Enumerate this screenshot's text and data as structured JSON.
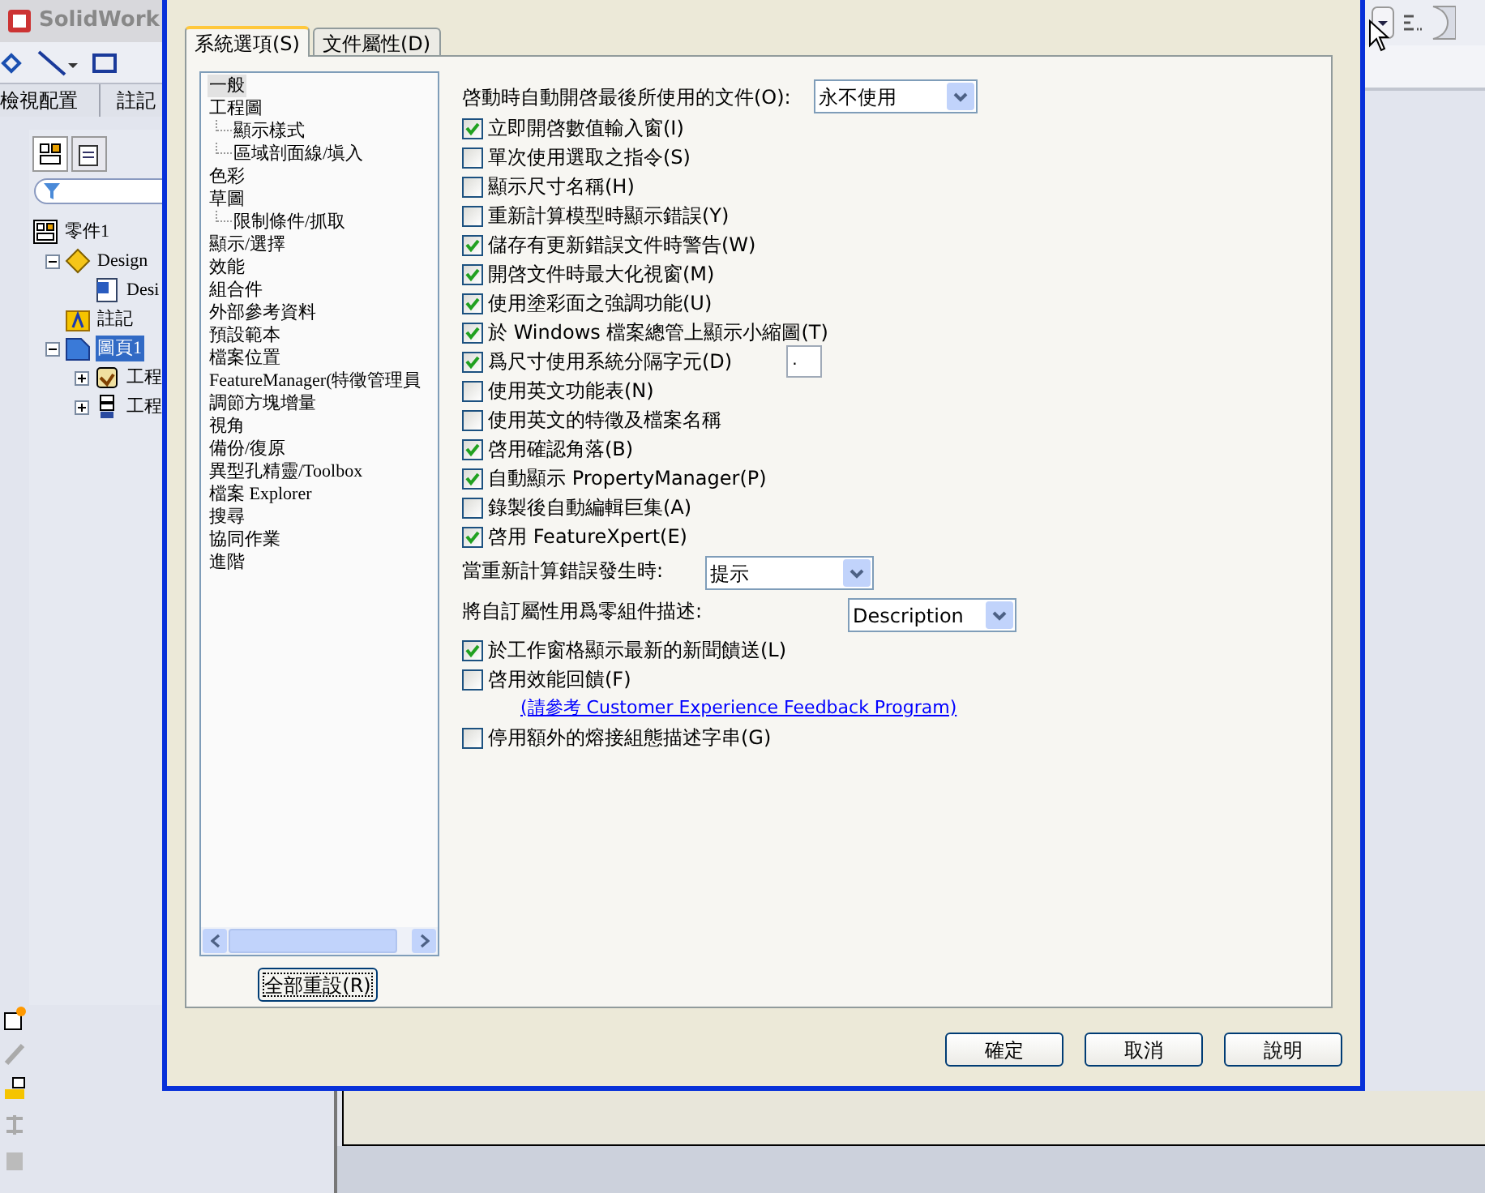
{
  "app": {
    "title": "SolidWork",
    "tabs": [
      {
        "label": "檢視配置",
        "selected": false
      },
      {
        "label": "註記",
        "selected": false
      }
    ],
    "tree": [
      {
        "label": "零件1",
        "selected": false,
        "children": [
          {
            "label": "Design",
            "selected": false,
            "expanded": true,
            "children": [
              {
                "label": "Desi",
                "selected": false
              }
            ]
          },
          {
            "label": "註記",
            "selected": false
          },
          {
            "label": "圖頁1",
            "selected": true,
            "expanded": true,
            "children": [
              {
                "label": "工程",
                "selected": false,
                "expanded": false
              },
              {
                "label": "工程",
                "selected": false,
                "expanded": false
              }
            ]
          }
        ]
      }
    ]
  },
  "dialog": {
    "tabs": [
      {
        "label": "系統選項(S)",
        "selected": true
      },
      {
        "label": "文件屬性(D)",
        "selected": false
      }
    ],
    "categories": [
      {
        "label": "一般",
        "selected": true
      },
      {
        "label": "工程圖",
        "selected": false,
        "children": [
          {
            "label": "顯示樣式",
            "selected": false
          },
          {
            "label": "區域剖面線/塡入",
            "selected": false
          }
        ]
      },
      {
        "label": "色彩",
        "selected": false
      },
      {
        "label": "草圖",
        "selected": false,
        "children": [
          {
            "label": "限制條件/抓取",
            "selected": false
          }
        ]
      },
      {
        "label": "顯示/選擇",
        "selected": false
      },
      {
        "label": "效能",
        "selected": false
      },
      {
        "label": "組合件",
        "selected": false
      },
      {
        "label": "外部參考資料",
        "selected": false
      },
      {
        "label": "預設範本",
        "selected": false
      },
      {
        "label": "檔案位置",
        "selected": false
      },
      {
        "label": "FeatureManager(特徵管理員",
        "selected": false
      },
      {
        "label": "調節方塊增量",
        "selected": false
      },
      {
        "label": "視角",
        "selected": false
      },
      {
        "label": "備份/復原",
        "selected": false
      },
      {
        "label": "異型孔精靈/Toolbox",
        "selected": false
      },
      {
        "label": "檔案 Explorer",
        "selected": false
      },
      {
        "label": "搜尋",
        "selected": false
      },
      {
        "label": "協同作業",
        "selected": false
      },
      {
        "label": "進階",
        "selected": false
      }
    ],
    "reset_button": "全部重設(R)",
    "settings": [
      {
        "kind": "dropdown",
        "label": "啓動時自動開啓最後所使用的文件(O):",
        "value": "永不使用"
      },
      {
        "kind": "checkbox",
        "label": "立即開啓數值輸入窗(I)",
        "checked": true
      },
      {
        "kind": "checkbox",
        "label": "單次使用選取之指令(S)",
        "checked": false
      },
      {
        "kind": "checkbox",
        "label": "顯示尺寸名稱(H)",
        "checked": false
      },
      {
        "kind": "checkbox",
        "label": "重新計算模型時顯示錯誤(Y)",
        "checked": false
      },
      {
        "kind": "checkbox",
        "label": "儲存有更新錯誤文件時警告(W)",
        "checked": true
      },
      {
        "kind": "checkbox",
        "label": "開啓文件時最大化視窗(M)",
        "checked": true
      },
      {
        "kind": "checkbox",
        "label": "使用塗彩面之強調功能(U)",
        "checked": true
      },
      {
        "kind": "checkbox",
        "label": "於 Windows 檔案總管上顯示小縮圖(T)",
        "checked": true
      },
      {
        "kind": "checkbox",
        "label": "爲尺寸使用系統分隔字元(D)",
        "checked": true,
        "field_value": "."
      },
      {
        "kind": "checkbox",
        "label": "使用英文功能表(N)",
        "checked": false
      },
      {
        "kind": "checkbox",
        "label": "使用英文的特徵及檔案名稱",
        "checked": false
      },
      {
        "kind": "checkbox",
        "label": "啓用確認角落(B)",
        "checked": true
      },
      {
        "kind": "checkbox",
        "label": "自動顯示 PropertyManager(P)",
        "checked": true
      },
      {
        "kind": "checkbox",
        "label": "錄製後自動編輯巨集(A)",
        "checked": false
      },
      {
        "kind": "checkbox",
        "label": "啓用 FeatureXpert(E)",
        "checked": true
      },
      {
        "kind": "dropdown",
        "label": "當重新計算錯誤發生時:",
        "value": "提示"
      },
      {
        "kind": "dropdown",
        "label": "將自訂屬性用爲零組件描述:",
        "value": "Description"
      },
      {
        "kind": "checkbox",
        "label": "於工作窗格顯示最新的新聞饋送(L)",
        "checked": true
      },
      {
        "kind": "checkbox",
        "label": "啓用效能回饋(F)",
        "checked": false
      },
      {
        "kind": "link",
        "label": "(請參考 Customer Experience Feedback Program)"
      },
      {
        "kind": "checkbox",
        "label": "停用額外的熔接組態描述字串(G)",
        "checked": false
      }
    ],
    "buttons": [
      "確定",
      "取消",
      "說明"
    ]
  }
}
